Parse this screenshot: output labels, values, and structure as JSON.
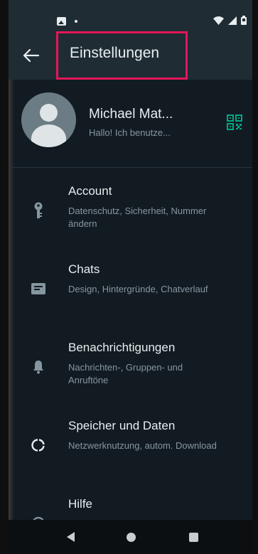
{
  "app_bar": {
    "title": "Einstellungen"
  },
  "profile": {
    "name": "Michael Mat...",
    "status": "Hallo! Ich benutze..."
  },
  "settings": [
    {
      "title": "Account",
      "subtitle": "Datenschutz, Sicherheit, Nummer ändern",
      "icon": "key-icon"
    },
    {
      "title": "Chats",
      "subtitle": "Design, Hintergründe, Chatverlauf",
      "icon": "chat-icon"
    },
    {
      "title": "Benachrichtigungen",
      "subtitle": "Nachrichten-, Gruppen- und Anruftöne",
      "icon": "bell-icon"
    },
    {
      "title": "Speicher und Daten",
      "subtitle": "Netzwerknutzung, autom. Download",
      "icon": "data-usage-icon"
    },
    {
      "title": "Hilfe",
      "subtitle": "",
      "icon": "help-icon"
    }
  ],
  "colors": {
    "background": "#121b22",
    "app_bar": "#1f2c34",
    "accent": "#00a884",
    "highlight": "#e3175a"
  },
  "nav": {
    "icons": [
      "nav-back-icon",
      "nav-home-icon",
      "nav-recents-icon"
    ]
  }
}
